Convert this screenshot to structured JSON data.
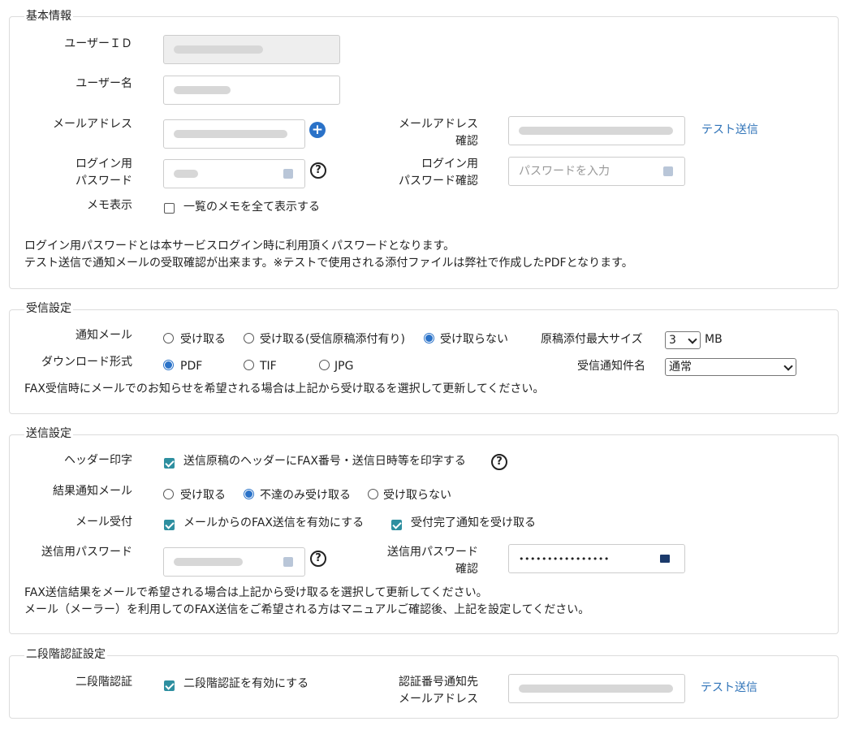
{
  "basic": {
    "legend": "基本情報",
    "user_id_label": "ユーザーＩＤ",
    "user_name_label": "ユーザー名",
    "email_label": "メールアドレス",
    "email_confirm_label_1": "メールアドレス",
    "email_confirm_label_2": "確認",
    "password_label_1": "ログイン用",
    "password_label_2": "パスワード",
    "password_confirm_label_1": "ログイン用",
    "password_confirm_label_2": "パスワード確認",
    "password_confirm_placeholder": "パスワードを入力",
    "memo_label": "メモ表示",
    "memo_checkbox_text": "一覧のメモを全て表示する",
    "test_send_link": "テスト送信",
    "note_1": "ログイン用パスワードとは本サービスログイン時に利用頂くパスワードとなります。",
    "note_2": "テスト送信で通知メールの受取確認が出来ます。※テストで使用される添付ファイルは弊社で作成したPDFとなります。"
  },
  "receive": {
    "legend": "受信設定",
    "notify_label": "通知メール",
    "notify_options": [
      "受け取る",
      "受け取る(受信原稿添付有り)",
      "受け取らない"
    ],
    "max_size_label": "原稿添付最大サイズ",
    "max_size_value": "3",
    "max_size_unit": "MB",
    "download_label": "ダウンロード形式",
    "download_options": [
      "PDF",
      "TIF",
      "JPG"
    ],
    "subject_label": "受信通知件名",
    "subject_value": "通常",
    "note": "FAX受信時にメールでのお知らせを希望される場合は上記から受け取るを選択して更新してください。"
  },
  "send": {
    "legend": "送信設定",
    "header_label": "ヘッダー印字",
    "header_checkbox_text": "送信原稿のヘッダーにFAX番号・送信日時等を印字する",
    "result_label": "結果通知メール",
    "result_options": [
      "受け取る",
      "不達のみ受け取る",
      "受け取らない"
    ],
    "mail_accept_label": "メール受付",
    "mail_accept_checkbox_1": "メールからのFAX送信を有効にする",
    "mail_accept_checkbox_2": "受付完了通知を受け取る",
    "password_label": "送信用パスワード",
    "password_confirm_label_1": "送信用パスワード",
    "password_confirm_label_2": "確認",
    "password_confirm_value": "••••••••••••••••",
    "note_1": "FAX送信結果をメールで希望される場合は上記から受け取るを選択して更新してください。",
    "note_2": "メール（メーラー）を利用してのFAX送信をご希望される方はマニュアルご確認後、上記を設定してください。"
  },
  "twofactor": {
    "legend": "二段階認証設定",
    "label": "二段階認証",
    "checkbox_text": "二段階認証を有効にする",
    "email_label_1": "認証番号通知先",
    "email_label_2": "メールアドレス",
    "test_send_link": "テスト送信"
  },
  "colors": {
    "accent": "#2a72c8",
    "checkbox": "#2e8fa0",
    "link": "#2f73b8"
  }
}
